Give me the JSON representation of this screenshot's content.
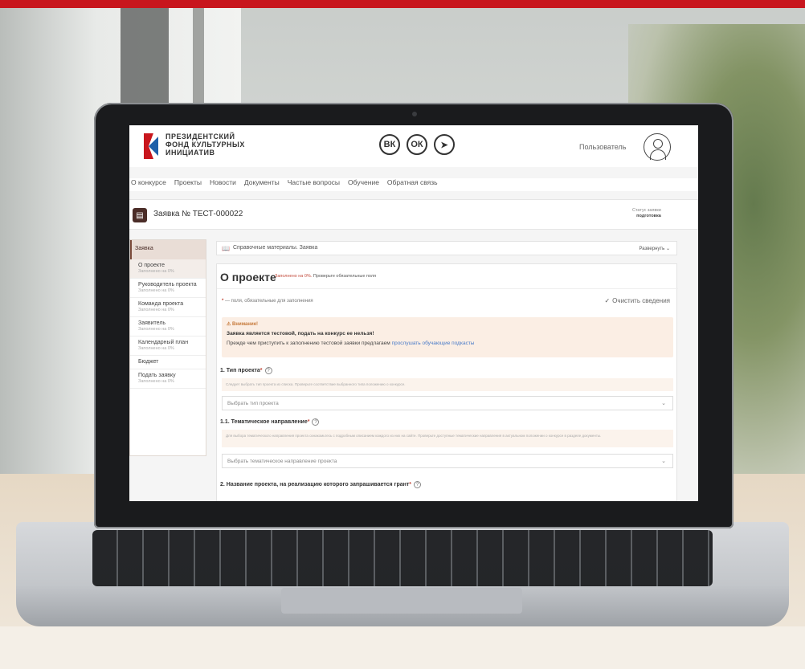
{
  "header": {
    "logo_lines": [
      "ПРЕЗИДЕНТСКИЙ",
      "ФОНД КУЛЬТУРНЫХ",
      "ИНИЦИАТИВ"
    ],
    "socials": [
      {
        "label": "vk",
        "glyph": "ВК"
      },
      {
        "label": "ok",
        "glyph": "ОК"
      },
      {
        "label": "telegram",
        "glyph": "➤"
      }
    ],
    "user_name": "Пользователь"
  },
  "nav": {
    "items": [
      "О конкурсе",
      "Проекты",
      "Новости",
      "Документы",
      "Частые вопросы",
      "Обучение",
      "Обратная связь"
    ]
  },
  "app": {
    "title_prefix": "Заявка №",
    "title_id": "ТЕСТ-000022",
    "status_label": "Статус заявки",
    "status_value": "подготовка"
  },
  "sidebar": {
    "heading": "Заявка",
    "items": [
      {
        "title": "О проекте",
        "sub": "Заполнено на 0%"
      },
      {
        "title": "Руководитель проекта",
        "sub": "Заполнено на 0%"
      },
      {
        "title": "Команда проекта",
        "sub": "Заполнено на 0%"
      },
      {
        "title": "Заявитель",
        "sub": "Заполнено на 0%"
      },
      {
        "title": "Календарный план",
        "sub": "Заполнено на 0%"
      },
      {
        "title": "Бюджет",
        "sub": ""
      },
      {
        "title": "Подать заявку",
        "sub": "Заполнено на 0%"
      }
    ]
  },
  "main": {
    "ref_label": "Справочные материалы. Заявка",
    "expand_label": "Развернуть",
    "page_title": "О проекте",
    "fill_status": "Заполнено на 0%.",
    "check_required": "Проверьте обязательные поля",
    "required_note": "— поля, обязательные для заполнения",
    "clear_label": "Очистить сведения",
    "warning": {
      "heading": "Внимание!",
      "bold": "Заявка является тестовой, подать на конкурс ее нельзя!",
      "text": "Прежде чем приступить к заполнению тестовой заявки предлагаем",
      "link": "прослушать обучающие подкасты"
    },
    "q1": {
      "title": "1. Тип проекта",
      "hint": "Следует выбрать тип проекта из списка. Проверьте соответствие выбранного типа положению о конкурсе.",
      "placeholder": "Выбрать тип проекта"
    },
    "q2": {
      "title": "1.1. Тематическое направление",
      "hint": "Для выбора тематического направления проекта ознакомьтесь с подробным описанием каждого из них на сайте. Проверьте доступные тематические направления в актуальном положении о конкурсе в разделе документы.",
      "placeholder": "Выбрать тематическое направление проекта"
    },
    "q3": {
      "title": "2. Название проекта, на реализацию которого запрашивается грант"
    }
  }
}
